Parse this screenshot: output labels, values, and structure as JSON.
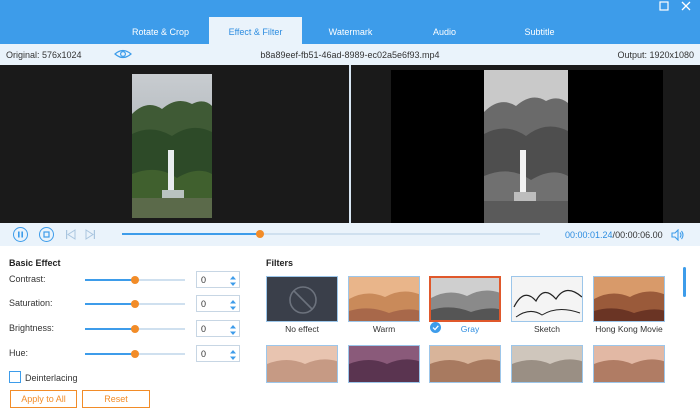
{
  "tabs": [
    {
      "label": "Rotate & Crop"
    },
    {
      "label": "Effect & Filter"
    },
    {
      "label": "Watermark"
    },
    {
      "label": "Audio"
    },
    {
      "label": "Subtitle"
    }
  ],
  "window": {
    "maximize_icon": "maximize-icon",
    "close_icon": "close-icon"
  },
  "info": {
    "original": "Original: 576x1024",
    "filename": "b8a89eef-fb51-46ad-8989-ec02a5e6f93.mp4",
    "output": "Output: 1920x1080"
  },
  "player": {
    "current_time": "00:00:01.24",
    "separator": "/",
    "duration": "00:00:06.00",
    "progress": 0.33
  },
  "basic_effect": {
    "title": "Basic Effect",
    "sliders": [
      {
        "label": "Contrast:",
        "value": "0",
        "level": 0.5
      },
      {
        "label": "Saturation:",
        "value": "0",
        "level": 0.5
      },
      {
        "label": "Brightness:",
        "value": "0",
        "level": 0.5
      },
      {
        "label": "Hue:",
        "value": "0",
        "level": 0.5
      }
    ],
    "deinterlacing": "Deinterlacing",
    "apply_all": "Apply to All",
    "reset": "Reset"
  },
  "filters": {
    "title": "Filters",
    "row1": [
      {
        "label": "No effect"
      },
      {
        "label": "Warm"
      },
      {
        "label": "Gray",
        "selected": true
      },
      {
        "label": "Sketch"
      },
      {
        "label": "Hong Kong Movie"
      }
    ]
  },
  "colors": {
    "accent": "#3d9cea",
    "orange": "#f28c28",
    "selected_border": "#e0582b"
  }
}
